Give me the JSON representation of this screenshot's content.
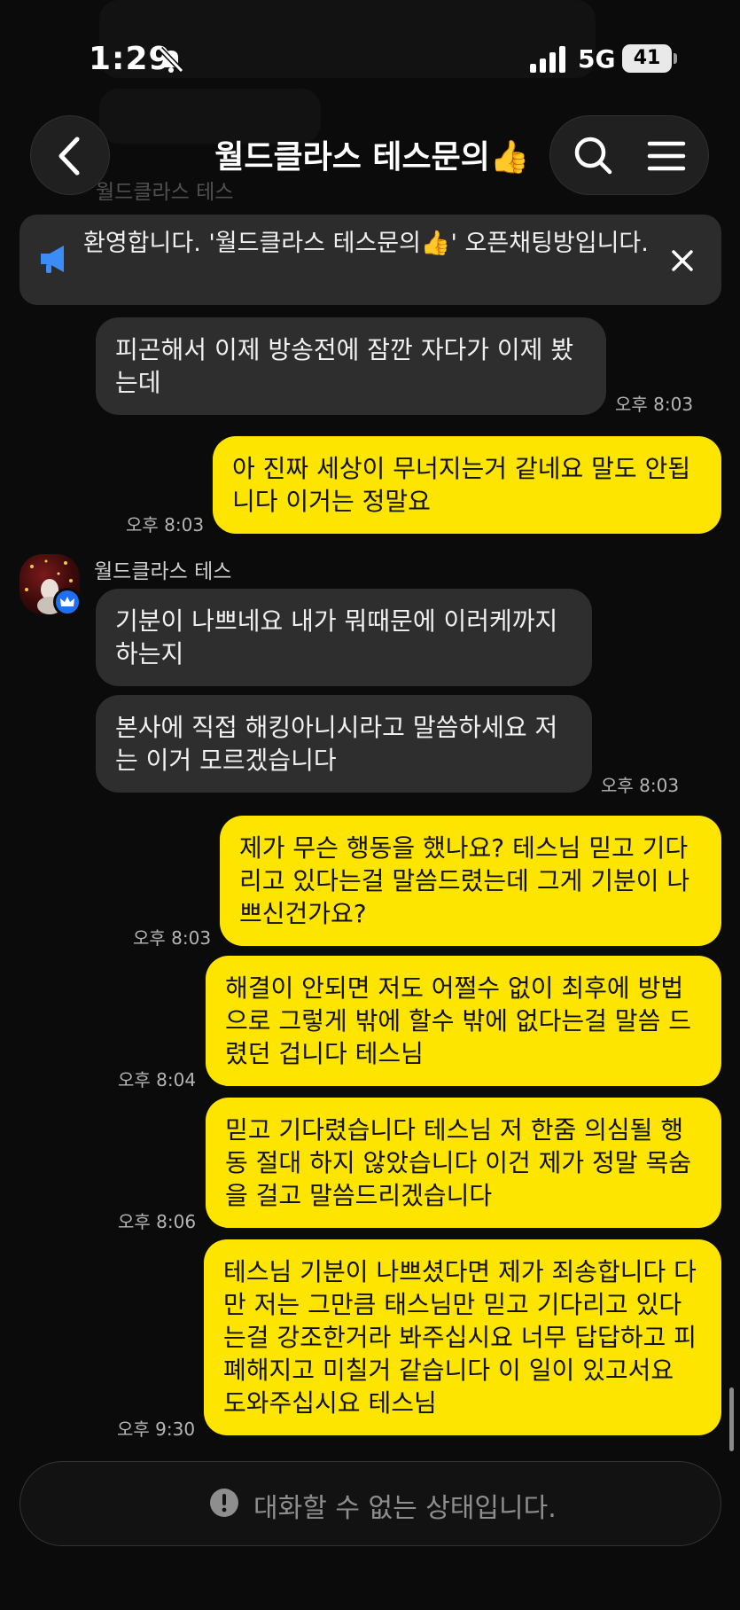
{
  "status_bar": {
    "time": "1:29",
    "network": "5G",
    "battery": "41"
  },
  "header": {
    "title": "월드클라스 테스문의👍"
  },
  "notice": {
    "text": "환영합니다. '월드클라스 테스문의👍' 오픈채팅방입니다."
  },
  "ghost_sender": "월드클라스 테스",
  "messages": [
    {
      "direction": "incoming",
      "text": "피곤해서 이제 방송전에 잠깐 자다가 이제 봤는데",
      "time": "오후 8:03"
    },
    {
      "direction": "outgoing",
      "text": "아 진짜 세상이 무너지는거 같네요 말도 안됩니다 이거는 정말요",
      "time": "오후 8:03"
    },
    {
      "direction": "incoming",
      "sender": "월드클라스 테스",
      "text": "기분이 나쁘네요 내가 뭐때문에 이러케까지 하는지",
      "time": ""
    },
    {
      "direction": "incoming",
      "text": "본사에 직접 해킹아니시라고 말씀하세요 저는 이거 모르겠습니다",
      "time": "오후 8:03"
    },
    {
      "direction": "outgoing",
      "text": "제가 무슨 행동을 했나요? 테스님 믿고 기다리고 있다는걸 말씀드렸는데 그게 기분이 나쁘신건가요?",
      "time": "오후 8:03"
    },
    {
      "direction": "outgoing",
      "text": "해결이 안되면 저도 어쩔수 없이 최후에 방법으로 그렇게 밖에 할수 밖에 없다는걸 말씀 드렸던 겁니다 테스님",
      "time": "오후 8:04"
    },
    {
      "direction": "outgoing",
      "text": "믿고 기다렸습니다 테스님 저 한줌 의심될 행동 절대 하지 않았습니다 이건 제가 정말 목숨을 걸고 말씀드리겠습니다",
      "time": "오후 8:06"
    },
    {
      "direction": "outgoing",
      "text": "테스님 기분이 나쁘셨다면 제가 죄송합니다 다만 저는 그만큼 태스님만 믿고 기다리고 있다는걸 강조한거라 봐주십시요 너무 답답하고 피폐해지고 미칠거 같습니다 이 일이 있고서요 도와주십시요 테스님",
      "time": "오후 9:30"
    }
  ],
  "input": {
    "placeholder": "대화할 수 없는 상태입니다."
  },
  "colors": {
    "outgoing_bubble": "#fee500",
    "incoming_bubble": "#2e2e2e",
    "background": "#0b0b0b",
    "notice_icon": "#3a8df7"
  }
}
